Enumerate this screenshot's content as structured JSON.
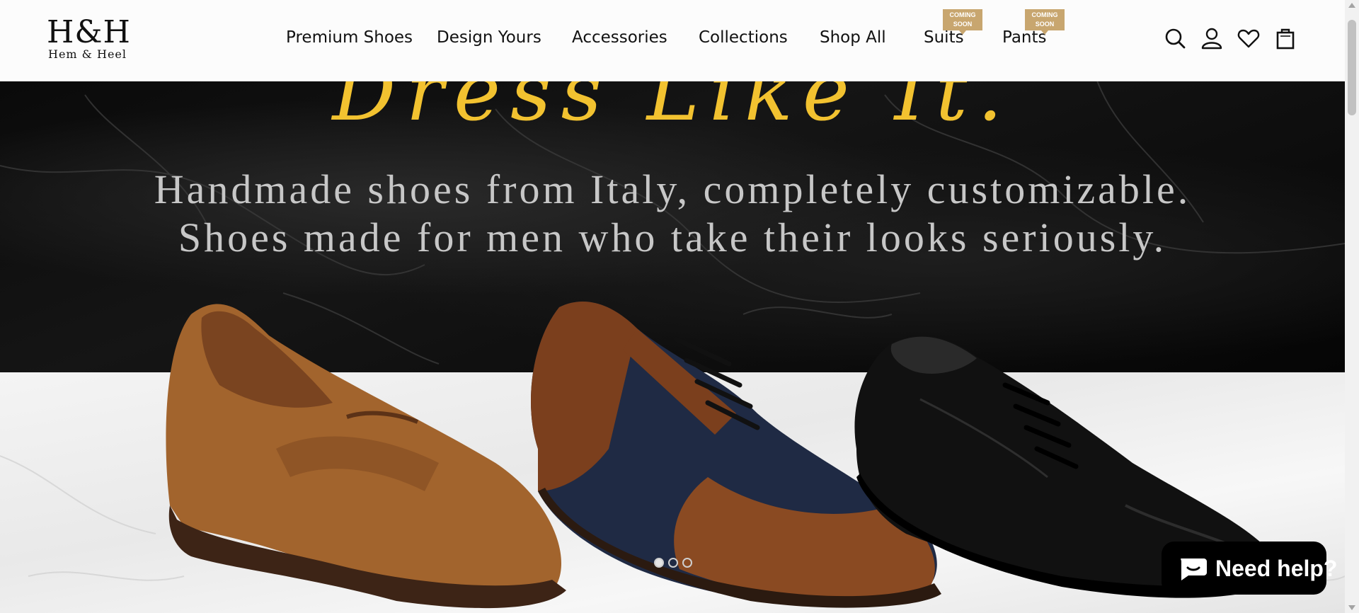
{
  "brand": {
    "mark": "H&H",
    "name": "Hem & Heel"
  },
  "nav": {
    "items": [
      {
        "label": "Premium Shoes"
      },
      {
        "label": "Design Yours"
      },
      {
        "label": "Accessories"
      },
      {
        "label": "Collections"
      },
      {
        "label": "Shop All"
      },
      {
        "label": "Suits",
        "badge": "COMING SOON"
      },
      {
        "label": "Pants",
        "badge": "COMING SOON"
      }
    ]
  },
  "header_icons": [
    "search-icon",
    "account-icon",
    "wishlist-heart-icon",
    "cart-bag-icon"
  ],
  "hero": {
    "title": "Dress Like It.",
    "subtitle_line1": "Handmade shoes from Italy, completely customizable.",
    "subtitle_line2": "Shoes made for men who take their looks seriously.",
    "slides_total": 3,
    "active_slide": 1,
    "title_color": "#f2c230"
  },
  "chat": {
    "label": "Need help?",
    "icon": "chat-bubble-icon"
  },
  "colors": {
    "badge": "#c8a66f",
    "chat_bg": "#000000",
    "header_bg": "#fcfcfc"
  }
}
